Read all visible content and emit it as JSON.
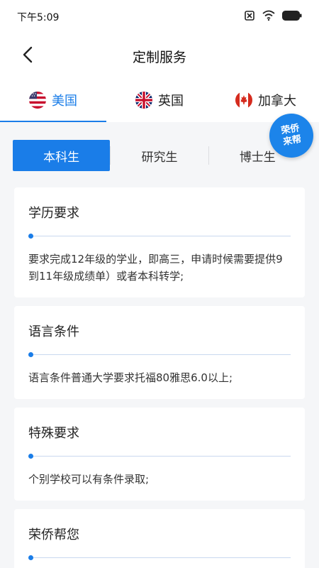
{
  "status": {
    "time": "下午5:09",
    "battery_color": "#222222"
  },
  "header": {
    "title": "定制服务"
  },
  "countries": [
    {
      "label": "美国",
      "flag": "us-flag-icon",
      "active": true
    },
    {
      "label": "英国",
      "flag": "uk-flag-icon",
      "active": false
    },
    {
      "label": "加拿大",
      "flag": "canada-flag-icon",
      "active": false
    }
  ],
  "levels": [
    {
      "label": "本科生",
      "active": true
    },
    {
      "label": "研究生",
      "active": false
    },
    {
      "label": "博士生",
      "active": false
    }
  ],
  "badge": {
    "line1": "荣侨",
    "line2": "来帮"
  },
  "cards": [
    {
      "title": "学历要求",
      "text": "要求完成12年级的学业，即高三，申请时候需要提供9到11年级成绩单）或者本科转学;"
    },
    {
      "title": "语言条件",
      "text": "语言条件普通大学要求托福80雅思6.0以上;"
    },
    {
      "title": "特殊要求",
      "text": "个别学校可以有条件录取;"
    },
    {
      "title": "荣侨帮您",
      "text": ""
    }
  ],
  "colors": {
    "accent": "#1a7de8",
    "background": "#f5f6f8"
  }
}
